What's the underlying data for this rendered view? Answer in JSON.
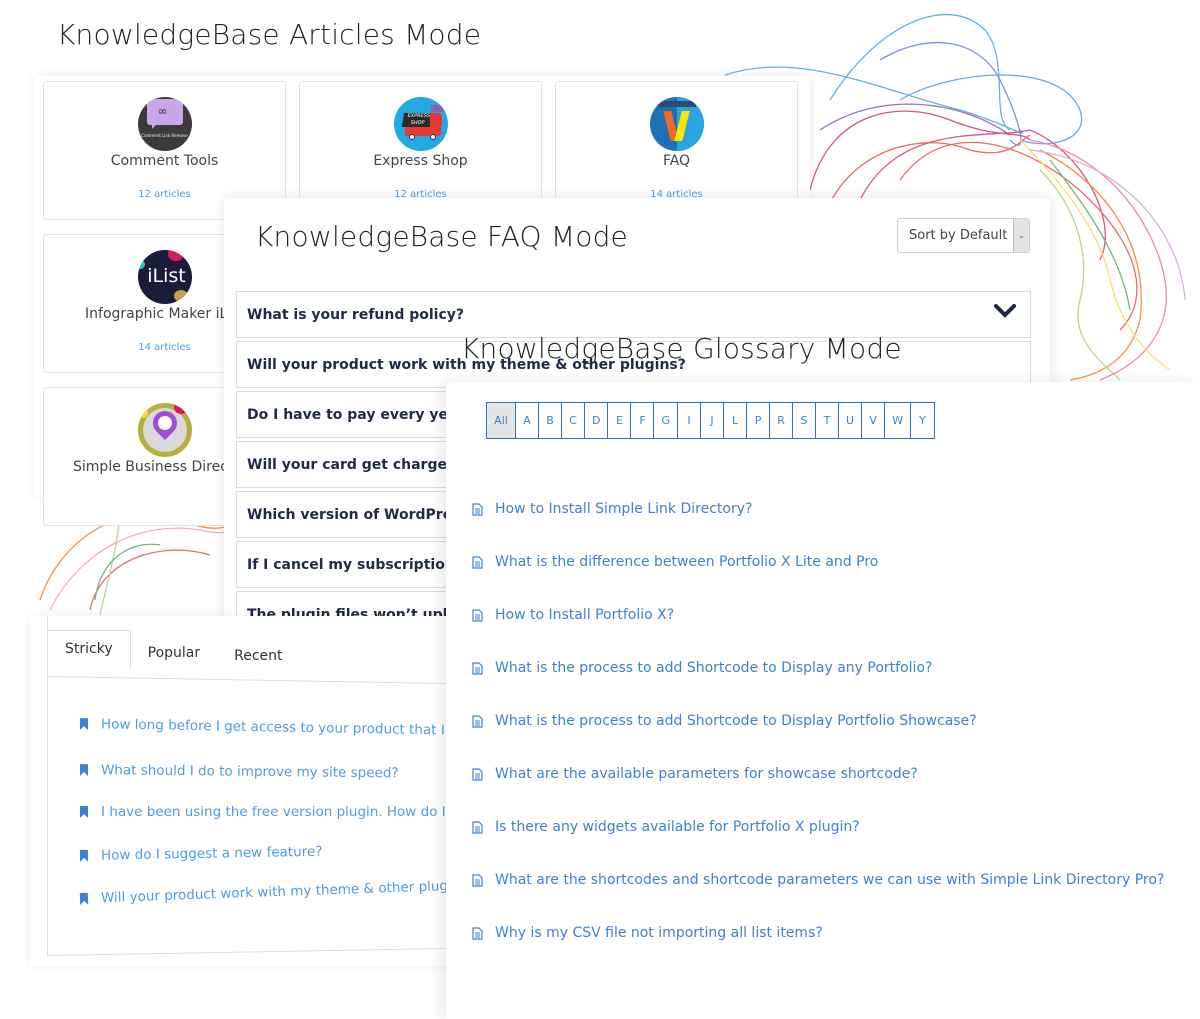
{
  "articles_mode": {
    "title": "KnowledgeBase Articles Mode",
    "cards": [
      {
        "name": "Comment Tools",
        "count": "12 articles",
        "icon": "comment-link-remove-logo",
        "logo_caption": "Comment Link Remove"
      },
      {
        "name": "Express Shop",
        "count": "12 articles",
        "icon": "express-shop-logo",
        "logo_caption": "EXPRESS SHOP"
      },
      {
        "name": "FAQ",
        "count": "14 articles",
        "icon": "portfolio-x-logo"
      },
      {
        "name": "Infographic Maker iList",
        "count": "14 articles",
        "icon": "ilist-logo",
        "logo_caption": "iList"
      },
      {
        "name": "Simple Business Directory",
        "count": "",
        "icon": "business-directory-logo"
      }
    ]
  },
  "faq_mode": {
    "title": "KnowledgeBase FAQ Mode",
    "sort_select": {
      "value": "Sort by Default"
    },
    "questions": [
      "What is your refund policy?",
      "Will your product work with my theme & other plugins?",
      "Do I have to pay every year?",
      "Will your card get charged automatically?",
      "Which version of WordPress do you support?",
      "If I cancel my subscription, can I still use the plugin?",
      "The plugin files won’t upload"
    ]
  },
  "glossary_mode": {
    "title": "KnowledgeBase Glossary Mode",
    "letters": [
      "All",
      "A",
      "B",
      "C",
      "D",
      "E",
      "F",
      "G",
      "I",
      "J",
      "L",
      "P",
      "R",
      "S",
      "T",
      "U",
      "V",
      "W",
      "Y"
    ],
    "active_letter": "All",
    "items": [
      "How to Install Simple Link Directory?",
      "What is the difference between Portfolio X Lite and Pro",
      "How to Install Portfolio X?",
      "What is the process to add Shortcode to Display any Portfolio?",
      "What is the process to add Shortcode to Display Portfolio Showcase?",
      "What are the available parameters for showcase shortcode?",
      "Is there any widgets available for Portfolio X plugin?",
      "What are the shortcodes and shortcode parameters we can use with Simple Link Directory Pro?",
      "Why is my CSV file not importing all list items?"
    ]
  },
  "widget": {
    "tabs": [
      "Stricky",
      "Popular",
      "Recent"
    ],
    "active_tab": "Stricky",
    "items": [
      "How long before I get access to your product that I just bought?",
      "What should I do to improve my site speed?",
      "I have been using the free version plugin. How do I upgrade?",
      "How do I suggest a new feature?",
      "Will your product work with my theme & other plugins?"
    ]
  },
  "colors": {
    "link": "#3b82d6",
    "widget_link": "#4a9ee8",
    "faq_question": "#1f2a44",
    "alpha_border": "#2f73b8"
  }
}
